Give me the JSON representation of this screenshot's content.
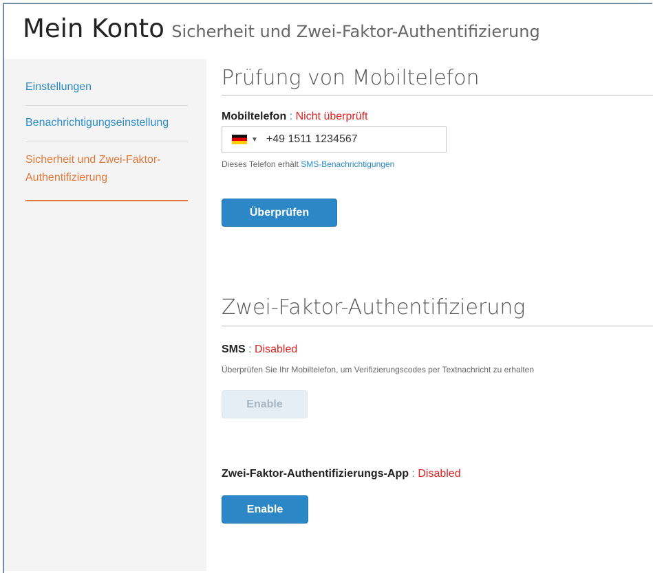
{
  "header": {
    "title": "Mein Konto",
    "subtitle": "Sicherheit und Zwei-Faktor-Authentifizierung"
  },
  "sidebar": {
    "items": [
      {
        "label": "Einstellungen"
      },
      {
        "label": "Benachrichtigungseinstellung"
      },
      {
        "label": "Sicherheit und Zwei-Faktor-Authentifizierung"
      }
    ]
  },
  "phone_section": {
    "title": "Prüfung von Mobiltelefon",
    "label": "Mobiltelefon",
    "separator": " : ",
    "status": "Nicht überprüft",
    "phone_value": "+49 1511 1234567",
    "country_icon": "germany-flag-icon",
    "hint_prefix": "Dieses Telefon erhält ",
    "hint_link": "SMS-Benachrichtigungen",
    "verify_button": "Überprüfen"
  },
  "twofa_section": {
    "title": "Zwei-Faktor-Authentifizierung",
    "sms_label": "SMS",
    "separator": " : ",
    "sms_status": "Disabled",
    "sms_hint": "Überprüfen Sie Ihr Mobiltelefon, um Verifizierungscodes per Textnachricht zu erhalten",
    "sms_button": "Enable",
    "app_label": "Zwei-Faktor-Authentifizierungs-App",
    "app_status": "Disabled",
    "app_button": "Enable"
  },
  "colors": {
    "link": "#2a8bc5",
    "active": "#e1793a",
    "error": "#dd2222",
    "primary_button": "#2b87c5"
  }
}
